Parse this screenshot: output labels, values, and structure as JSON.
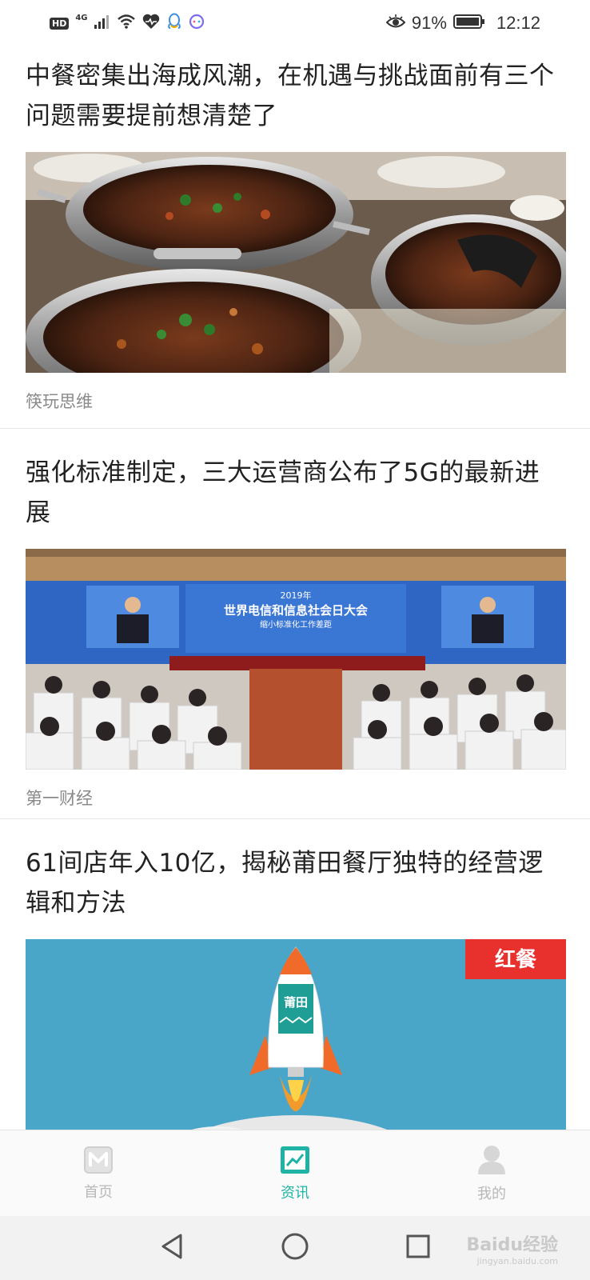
{
  "status_bar": {
    "hd": "HD",
    "network": "4G",
    "battery_pct": "91%",
    "time": "12:12"
  },
  "feed": {
    "articles": [
      {
        "title": "中餐密集出海成风潮，在机遇与挑战面前有三个问题需要提前想清楚了",
        "source": "筷玩思维",
        "image": "food-pans-photo"
      },
      {
        "title": "强化标准制定，三大运营商公布了5G的最新进展",
        "source": "第一财经",
        "image": "conference-photo",
        "image_text": {
          "year": "2019年",
          "headline": "世界电信和信息社会日大会",
          "subline": "缩小标准化工作差距"
        }
      },
      {
        "title": "61间店年入10亿，揭秘莆田餐厅独特的经营逻辑和方法",
        "source": "",
        "image": "rocket-illustration",
        "image_text": {
          "badge": "红餐",
          "rocket_label": "莆田"
        }
      }
    ]
  },
  "bottom_nav": {
    "items": [
      {
        "label": "首页",
        "icon": "home-icon",
        "active": false
      },
      {
        "label": "资讯",
        "icon": "trend-icon",
        "active": true
      },
      {
        "label": "我的",
        "icon": "profile-icon",
        "active": false
      }
    ],
    "accent": "#1fb3a5"
  },
  "system_nav": {
    "back": "back-icon",
    "home": "home-circle-icon",
    "recents": "recents-icon"
  },
  "watermark": {
    "brand": "Baidu经验",
    "url": "jingyan.baidu.com"
  }
}
